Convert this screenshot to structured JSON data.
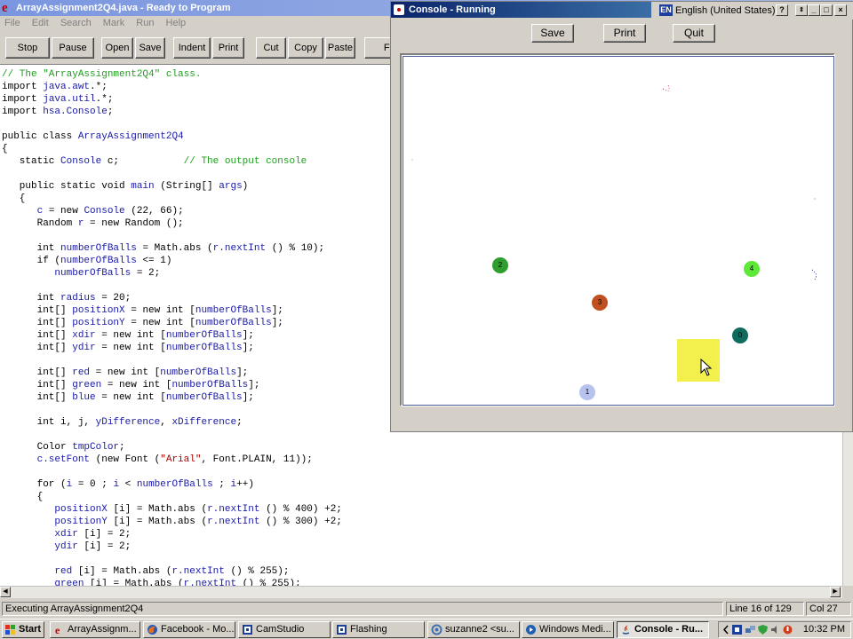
{
  "editor": {
    "title": "ArrayAssignment2Q4.java - Ready to Program",
    "menu": [
      "File",
      "Edit",
      "Search",
      "Mark",
      "Run",
      "Help"
    ],
    "toolbar": [
      "Stop",
      "Pause",
      "Open",
      "Save",
      "Indent",
      "Print",
      "Cut",
      "Copy",
      "Paste",
      "Fi"
    ],
    "code": [
      [
        [
          "c",
          "// The \"ArrayAssignment2Q4\" class."
        ]
      ],
      [
        [
          "k",
          "import "
        ],
        [
          "i",
          "java.awt"
        ],
        [
          "k",
          ".*;"
        ]
      ],
      [
        [
          "k",
          "import "
        ],
        [
          "i",
          "java.util"
        ],
        [
          "k",
          ".*;"
        ]
      ],
      [
        [
          "k",
          "import "
        ],
        [
          "i",
          "hsa.Console"
        ],
        [
          "k",
          ";"
        ]
      ],
      [
        [
          "k",
          ""
        ]
      ],
      [
        [
          "k",
          "public class "
        ],
        [
          "i",
          "ArrayAssignment2Q4"
        ]
      ],
      [
        [
          "k",
          "{"
        ]
      ],
      [
        [
          "k",
          "   static "
        ],
        [
          "i",
          "Console"
        ],
        [
          "k",
          " c;           "
        ],
        [
          "c",
          "// The output console"
        ]
      ],
      [
        [
          "k",
          ""
        ]
      ],
      [
        [
          "k",
          "   public static void "
        ],
        [
          "i",
          "main"
        ],
        [
          "k",
          " (String[] "
        ],
        [
          "i",
          "args"
        ],
        [
          "k",
          ")"
        ]
      ],
      [
        [
          "k",
          "   {"
        ]
      ],
      [
        [
          "k",
          "      "
        ],
        [
          "i",
          "c"
        ],
        [
          "k",
          " = new "
        ],
        [
          "i",
          "Console"
        ],
        [
          "k",
          " (22, 66);"
        ]
      ],
      [
        [
          "k",
          "      Random "
        ],
        [
          "i",
          "r"
        ],
        [
          "k",
          " = new Random ();"
        ]
      ],
      [
        [
          "k",
          ""
        ]
      ],
      [
        [
          "k",
          "      int "
        ],
        [
          "i",
          "numberOfBalls"
        ],
        [
          "k",
          " = Math.abs ("
        ],
        [
          "i",
          "r.nextInt"
        ],
        [
          "k",
          " () % 10);"
        ]
      ],
      [
        [
          "k",
          "      if ("
        ],
        [
          "i",
          "numberOfBalls"
        ],
        [
          "k",
          " <= 1)"
        ]
      ],
      [
        [
          "k",
          "         "
        ],
        [
          "i",
          "numberOfBalls"
        ],
        [
          "k",
          " = 2;"
        ]
      ],
      [
        [
          "k",
          ""
        ]
      ],
      [
        [
          "k",
          "      int "
        ],
        [
          "i",
          "radius"
        ],
        [
          "k",
          " = 20;"
        ]
      ],
      [
        [
          "k",
          "      int[] "
        ],
        [
          "i",
          "positionX"
        ],
        [
          "k",
          " = new int ["
        ],
        [
          "i",
          "numberOfBalls"
        ],
        [
          "k",
          "];"
        ]
      ],
      [
        [
          "k",
          "      int[] "
        ],
        [
          "i",
          "positionY"
        ],
        [
          "k",
          " = new int ["
        ],
        [
          "i",
          "numberOfBalls"
        ],
        [
          "k",
          "];"
        ]
      ],
      [
        [
          "k",
          "      int[] "
        ],
        [
          "i",
          "xdir"
        ],
        [
          "k",
          " = new int ["
        ],
        [
          "i",
          "numberOfBalls"
        ],
        [
          "k",
          "];"
        ]
      ],
      [
        [
          "k",
          "      int[] "
        ],
        [
          "i",
          "ydir"
        ],
        [
          "k",
          " = new int ["
        ],
        [
          "i",
          "numberOfBalls"
        ],
        [
          "k",
          "];"
        ]
      ],
      [
        [
          "k",
          ""
        ]
      ],
      [
        [
          "k",
          "      int[] "
        ],
        [
          "i",
          "red"
        ],
        [
          "k",
          " = new int ["
        ],
        [
          "i",
          "numberOfBalls"
        ],
        [
          "k",
          "];"
        ]
      ],
      [
        [
          "k",
          "      int[] "
        ],
        [
          "i",
          "green"
        ],
        [
          "k",
          " = new int ["
        ],
        [
          "i",
          "numberOfBalls"
        ],
        [
          "k",
          "];"
        ]
      ],
      [
        [
          "k",
          "      int[] "
        ],
        [
          "i",
          "blue"
        ],
        [
          "k",
          " = new int ["
        ],
        [
          "i",
          "numberOfBalls"
        ],
        [
          "k",
          "];"
        ]
      ],
      [
        [
          "k",
          ""
        ]
      ],
      [
        [
          "k",
          "      int i, j, "
        ],
        [
          "i",
          "yDifference"
        ],
        [
          "k",
          ", "
        ],
        [
          "i",
          "xDifference"
        ],
        [
          "k",
          ";"
        ]
      ],
      [
        [
          "k",
          ""
        ]
      ],
      [
        [
          "k",
          "      Color "
        ],
        [
          "i",
          "tmpColor"
        ],
        [
          "k",
          ";"
        ]
      ],
      [
        [
          "k",
          "      "
        ],
        [
          "i",
          "c.setFont"
        ],
        [
          "k",
          " (new Font ("
        ],
        [
          "s",
          "\"Arial\""
        ],
        [
          "k",
          ", Font.PLAIN, 11));"
        ]
      ],
      [
        [
          "k",
          ""
        ]
      ],
      [
        [
          "k",
          "      for ("
        ],
        [
          "i",
          "i"
        ],
        [
          "k",
          " = 0 ; "
        ],
        [
          "i",
          "i"
        ],
        [
          "k",
          " < "
        ],
        [
          "i",
          "numberOfBalls"
        ],
        [
          "k",
          " ; "
        ],
        [
          "i",
          "i"
        ],
        [
          "k",
          "++)"
        ]
      ],
      [
        [
          "k",
          "      {"
        ]
      ],
      [
        [
          "k",
          "         "
        ],
        [
          "i",
          "positionX"
        ],
        [
          "k",
          " [i] = Math.abs ("
        ],
        [
          "i",
          "r.nextInt"
        ],
        [
          "k",
          " () % 400) +2;"
        ]
      ],
      [
        [
          "k",
          "         "
        ],
        [
          "i",
          "positionY"
        ],
        [
          "k",
          " [i] = Math.abs ("
        ],
        [
          "i",
          "r.nextInt"
        ],
        [
          "k",
          " () % 300) +2;"
        ]
      ],
      [
        [
          "k",
          "         "
        ],
        [
          "i",
          "xdir"
        ],
        [
          "k",
          " [i] = 2;"
        ]
      ],
      [
        [
          "k",
          "         "
        ],
        [
          "i",
          "ydir"
        ],
        [
          "k",
          " [i] = 2;"
        ]
      ],
      [
        [
          "k",
          ""
        ]
      ],
      [
        [
          "k",
          "         "
        ],
        [
          "i",
          "red"
        ],
        [
          "k",
          " [i] = Math.abs ("
        ],
        [
          "i",
          "r.nextInt"
        ],
        [
          "k",
          " () % 255);"
        ]
      ],
      [
        [
          "k",
          "         "
        ],
        [
          "i",
          "green"
        ],
        [
          "k",
          " [i] = Math.abs ("
        ],
        [
          "i",
          "r.nextInt"
        ],
        [
          "k",
          " () % 255);"
        ]
      ]
    ],
    "status": {
      "message": "Executing ArrayAssignment2Q4",
      "line": "Line 16 of 129",
      "col": "Col 27"
    }
  },
  "console": {
    "title": "Console - Running",
    "buttons": [
      "Save",
      "Print",
      "Quit"
    ],
    "language": {
      "badge": "EN",
      "label": "English (United States)"
    },
    "balls": [
      {
        "label": "2",
        "color": "#2e9e2e"
      },
      {
        "label": "4",
        "color": "#5ee83a"
      },
      {
        "label": "3",
        "color": "#c0501e"
      },
      {
        "label": "0",
        "color": "#0e6b5e"
      },
      {
        "label": "1",
        "color": "#b8c2ee"
      }
    ]
  },
  "taskbar": {
    "start": "Start",
    "items": [
      {
        "label": "ArrayAssignm...",
        "icon": "ready-icon",
        "active": false
      },
      {
        "label": "Facebook - Mo...",
        "icon": "firefox-icon",
        "active": false
      },
      {
        "label": "CamStudio",
        "icon": "camstudio-icon",
        "active": false
      },
      {
        "label": "Flashing",
        "icon": "camstudio-icon",
        "active": false
      },
      {
        "label": "suzanne2 <su...",
        "icon": "mail-icon",
        "active": false
      },
      {
        "label": "Windows Medi...",
        "icon": "media-player-icon",
        "active": false
      },
      {
        "label": "Console - Ru...",
        "icon": "java-icon",
        "active": true
      }
    ],
    "clock": "10:32 PM"
  }
}
